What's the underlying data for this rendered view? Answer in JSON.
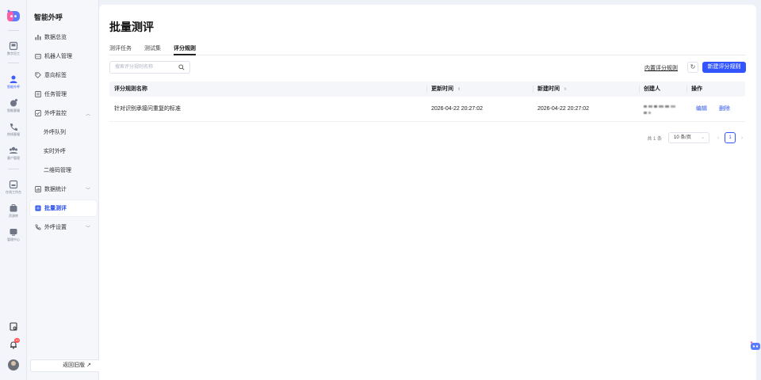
{
  "rail": {
    "items": [
      {
        "label": "数字员工",
        "icon": "digital-employee-icon"
      },
      {
        "label": "智能外呼",
        "icon": "outbound-call-icon"
      },
      {
        "label": "智能客服",
        "icon": "smart-service-icon"
      },
      {
        "label": "热线客服",
        "icon": "hotline-icon"
      },
      {
        "label": "客户管理",
        "icon": "customer-icon"
      },
      {
        "label": "在线工作台",
        "icon": "workbench-icon"
      },
      {
        "label": "资源库",
        "icon": "resource-icon"
      },
      {
        "label": "管理中心",
        "icon": "admin-icon"
      }
    ],
    "notification_count": "10"
  },
  "sidebar": {
    "title": "智能外呼",
    "items": [
      {
        "label": "数据总览"
      },
      {
        "label": "机器人管理"
      },
      {
        "label": "意向标签"
      },
      {
        "label": "任务管理"
      },
      {
        "label": "外呼监控"
      },
      {
        "label": "外呼队列"
      },
      {
        "label": "实时外呼"
      },
      {
        "label": "二维码管理"
      },
      {
        "label": "数据统计"
      },
      {
        "label": "批量测评"
      },
      {
        "label": "外呼设置"
      }
    ],
    "back_label": "返回旧版",
    "back_arrow": "↗"
  },
  "main": {
    "title": "批量测评",
    "tabs": [
      {
        "label": "测评任务"
      },
      {
        "label": "测试集"
      },
      {
        "label": "评分规则"
      }
    ],
    "search_placeholder": "搜索评分规则名称",
    "builtin_rules_label": "内置评分规则",
    "new_rule_label": "新建评分规则",
    "table": {
      "columns": [
        "评分规则名称",
        "更新时间",
        "新建时间",
        "创建人",
        "操作"
      ],
      "sort_glyph": "⬍",
      "rows": [
        {
          "name": "针对识别承接问重复的标准",
          "updated": "2026-04-22 20:27:02",
          "created": "2026-04-22 20:27:02",
          "creator": "",
          "edit": "编辑",
          "delete": "删除"
        }
      ]
    },
    "pager": {
      "total": "共 1 条",
      "page_size": "10 条/页",
      "current": "1",
      "prev": "‹",
      "next": "›",
      "dropdown": "⌄"
    }
  },
  "colors": {
    "accent": "#3355ff",
    "link": "#2f54eb",
    "danger_badge": "#ff4d4f"
  }
}
